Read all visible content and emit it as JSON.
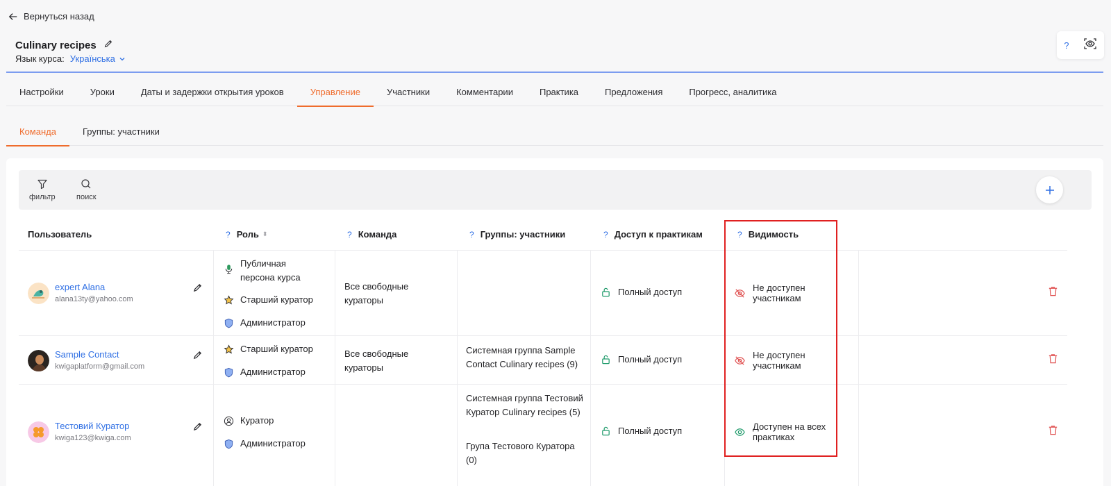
{
  "header": {
    "back_label": "Вернуться назад",
    "course_title": "Culinary recipes",
    "lang_label": "Язык курса:",
    "lang_value": "Українська",
    "help_label": "?"
  },
  "tabs": [
    {
      "label": "Настройки",
      "active": false
    },
    {
      "label": "Уроки",
      "active": false
    },
    {
      "label": "Даты и задержки открытия уроков",
      "active": false
    },
    {
      "label": "Управление",
      "active": true
    },
    {
      "label": "Участники",
      "active": false
    },
    {
      "label": "Комментарии",
      "active": false
    },
    {
      "label": "Практика",
      "active": false
    },
    {
      "label": "Предложения",
      "active": false
    },
    {
      "label": "Прогресс, аналитика",
      "active": false
    }
  ],
  "subtabs": [
    {
      "label": "Команда",
      "active": true
    },
    {
      "label": "Группы: участники",
      "active": false
    }
  ],
  "toolbar": {
    "filter_label": "фильтр",
    "search_label": "поиск"
  },
  "table": {
    "help_mark": "?",
    "columns": {
      "user": "Пользователь",
      "role": "Роль",
      "team": "Команда",
      "groups": "Группы: участники",
      "practice_access": "Доступ к практикам",
      "visibility": "Видимость"
    },
    "rows": [
      {
        "name": "expert Alana",
        "email": "alana13ty@yahoo.com",
        "roles": [
          {
            "icon": "microphone-icon",
            "label": "Публичная персона курса"
          },
          {
            "icon": "star-icon",
            "label": "Старший куратор"
          },
          {
            "icon": "shield-icon",
            "label": "Администратор"
          }
        ],
        "team": "Все свободные кураторы",
        "groups": [],
        "access": "Полный доступ",
        "visibility": "Не доступен участникам",
        "visibility_icon": "eye-off-icon"
      },
      {
        "name": "Sample Contact",
        "email": "kwigaplatform@gmail.com",
        "roles": [
          {
            "icon": "star-icon",
            "label": "Старший куратор"
          },
          {
            "icon": "shield-icon",
            "label": "Администратор"
          }
        ],
        "team": "Все свободные кураторы",
        "groups": [
          "Системная группа Sample Contact Culinary recipes (9)"
        ],
        "access": "Полный доступ",
        "visibility": "Не доступен участникам",
        "visibility_icon": "eye-off-icon"
      },
      {
        "name": "Тестовий Куратор",
        "email": "kwiga123@kwiga.com",
        "roles": [
          {
            "icon": "user-circle-icon",
            "label": "Куратор"
          },
          {
            "icon": "shield-icon",
            "label": "Администратор"
          }
        ],
        "team": "",
        "groups": [
          "Системная группа Тестовий Куратор Culinary recipes (5)",
          "Група Тестового Куратора (0)"
        ],
        "access": "Полный доступ",
        "visibility": "Доступен на всех практиках",
        "visibility_icon": "eye-icon"
      }
    ]
  },
  "colors": {
    "accent": "#ef6c2d",
    "link": "#2f6fe4",
    "success": "#1e9a6a",
    "danger": "#e05252",
    "highlight": "#e02020"
  }
}
